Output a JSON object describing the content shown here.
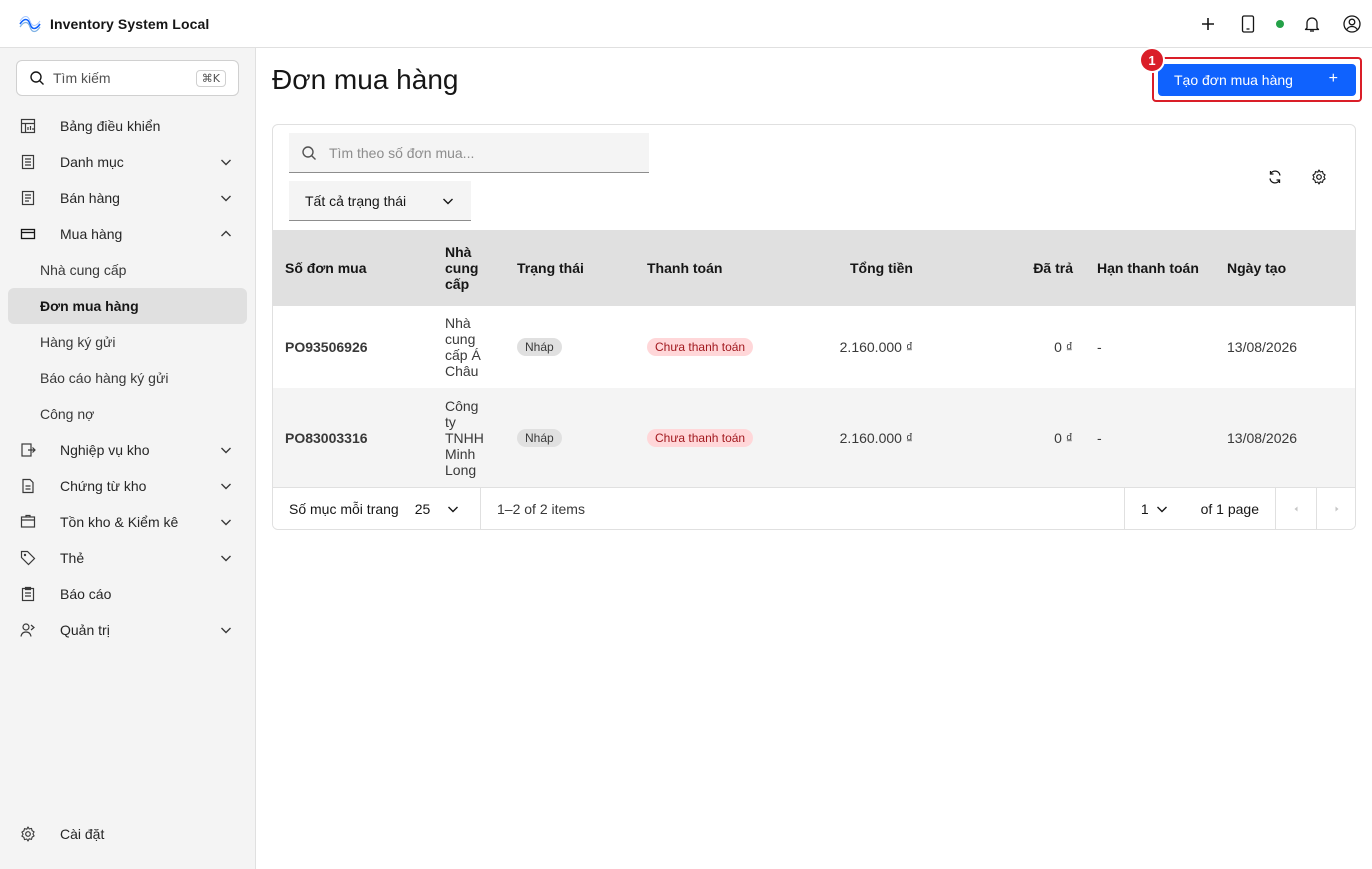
{
  "app": {
    "title": "Inventory System Local"
  },
  "sidebar": {
    "search_placeholder": "Tìm kiếm",
    "search_shortcut": "⌘K",
    "items": [
      {
        "label": "Bảng điều khiển",
        "icon": "dashboard-icon"
      },
      {
        "label": "Danh mục",
        "icon": "catalog-icon"
      },
      {
        "label": "Bán hàng",
        "icon": "sales-icon"
      },
      {
        "label": "Mua hàng",
        "icon": "purchase-icon"
      },
      {
        "label": "Nghiệp vụ kho",
        "icon": "warehouse-ops-icon"
      },
      {
        "label": "Chứng từ kho",
        "icon": "document-icon"
      },
      {
        "label": "Tồn kho & Kiểm kê",
        "icon": "inventory-icon"
      },
      {
        "label": "Thẻ",
        "icon": "tag-icon"
      },
      {
        "label": "Báo cáo",
        "icon": "report-icon"
      },
      {
        "label": "Quản trị",
        "icon": "admin-icon"
      }
    ],
    "purchase_sub": [
      "Nhà cung cấp",
      "Đơn mua hàng",
      "Hàng ký gửi",
      "Báo cáo hàng ký gửi",
      "Công nợ"
    ],
    "settings": "Cài đặt"
  },
  "main": {
    "title": "Đơn mua hàng",
    "create_button": "Tạo đơn mua hàng",
    "create_plus": "+",
    "annotation_badge": "1",
    "search_placeholder": "Tìm theo số đơn mua...",
    "status_filter": "Tất cả trạng thái",
    "columns": [
      "Số đơn mua",
      "Nhà cung cấp",
      "Trạng thái",
      "Thanh toán",
      "Tổng tiền",
      "Đã trả",
      "Hạn thanh toán",
      "Ngày tạo"
    ],
    "rows": [
      {
        "po": "PO93506926",
        "supplier": "Nhà cung cấp Á Châu",
        "status": "Nháp",
        "payment": "Chưa thanh toán",
        "total": "2.160.000 ₫",
        "paid": "0 ₫",
        "due": "-",
        "created": "13/08/2026"
      },
      {
        "po": "PO83003316",
        "supplier": "Công ty TNHH Minh Long",
        "status": "Nháp",
        "payment": "Chưa thanh toán",
        "total": "2.160.000 ₫",
        "paid": "0 ₫",
        "due": "-",
        "created": "13/08/2026"
      }
    ],
    "pagination": {
      "per_page_label": "Số mục mỗi trang",
      "per_page": "25",
      "items_text": "1–2 of 2 items",
      "page": "1",
      "of_pages": "of 1 page"
    }
  },
  "colors": {
    "primary": "#0f62fe",
    "danger": "#da1e28",
    "online": "#24a148"
  }
}
